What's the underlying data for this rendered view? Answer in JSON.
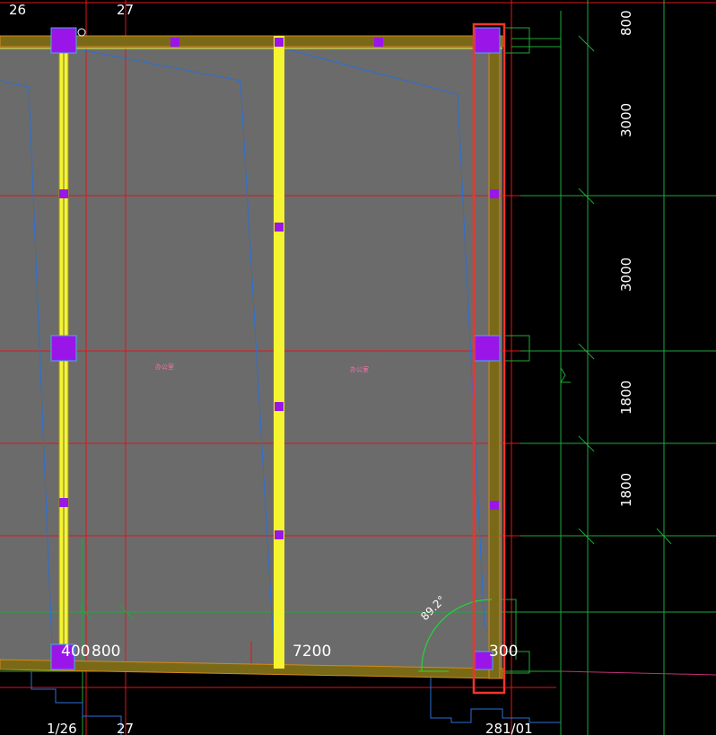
{
  "colors": {
    "background": "#000000",
    "slab_fill": "#6b6b6b",
    "grid_red": "#e0141a",
    "grid_green": "#1fa83a",
    "beam_yellow": "#f4f430",
    "column_purple": "#9a16e8",
    "blue_line": "#2a6fd6",
    "selection_red": "#f2342a",
    "edge_orange": "#d28a18",
    "text_white": "#ffffff",
    "room_label_pink": "#ff6fa8"
  },
  "axis_labels_top": [
    "26",
    "27"
  ],
  "axis_labels_bottom": [
    "1/26",
    "26",
    "27",
    "28",
    "1/01"
  ],
  "right_dimensions": [
    "800",
    "3000",
    "3000",
    "1800",
    "1800"
  ],
  "bottom_dimensions": [
    "400",
    "800",
    "7200",
    "300"
  ],
  "angle_annotation": "89.2°",
  "room_labels": [
    "办公室",
    "办公室"
  ]
}
